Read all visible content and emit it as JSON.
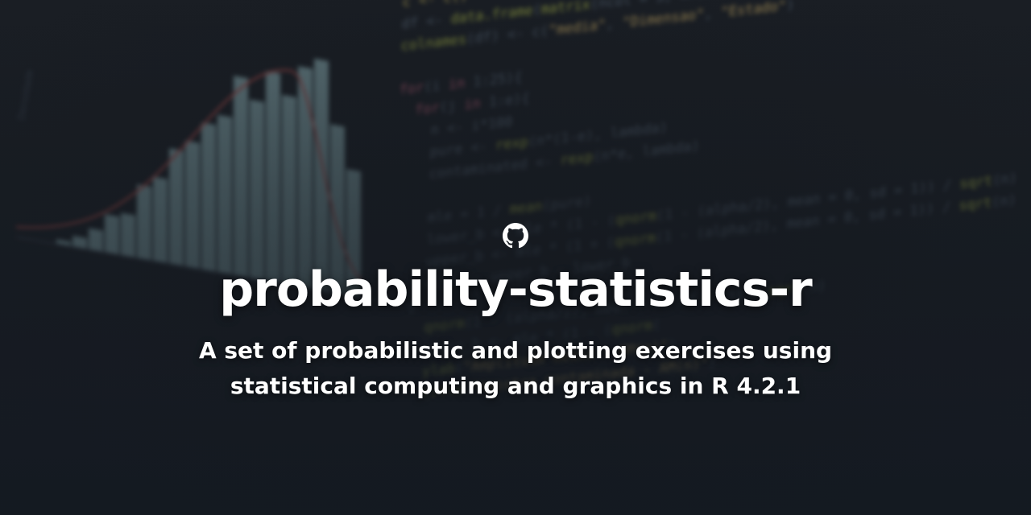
{
  "repo": {
    "icon": "github-icon",
    "name": "probability-statistics-r",
    "description": "A set of probabilistic and plotting exercises using statistical computing and graphics in R 4.2.1"
  },
  "colors": {
    "background": "#181c22",
    "text": "#ffffff",
    "histogram_bar": "#8fb3b8",
    "density_curve": "#c0504d"
  }
}
